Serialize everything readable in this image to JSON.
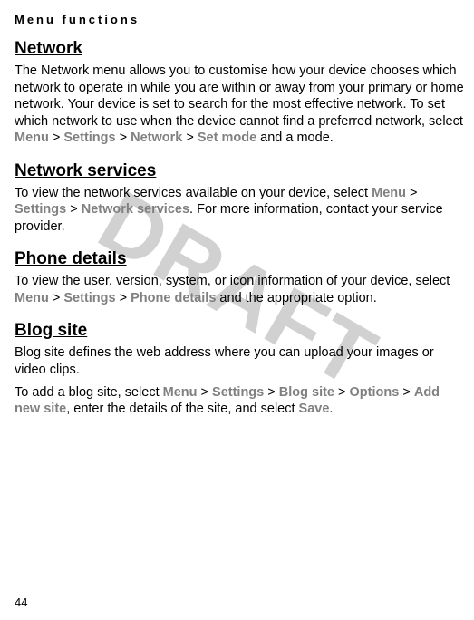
{
  "header": "Menu functions",
  "watermark": "DRAFT",
  "pageNumber": "44",
  "sections": {
    "network": {
      "heading": "Network",
      "p1_a": "The Network menu allows you to customise how your device chooses which network to operate in while you are within or away from your primary or home network. Your device is set to search for the most effective network. To set which network to use when the device cannot find a preferred network, select ",
      "p1_path1": "Menu",
      "p1_sep1": " > ",
      "p1_path2": "Settings",
      "p1_sep2": " > ",
      "p1_path3": "Network",
      "p1_sep3": " > ",
      "p1_path4": "Set mode",
      "p1_b": " and a mode."
    },
    "netServices": {
      "heading": "Network services",
      "p1_a": "To view the network services available on your device, select ",
      "p1_path1": "Menu",
      "p1_sep1": " > ",
      "p1_path2": "Settings",
      "p1_sep2": " > ",
      "p1_path3": "Network services",
      "p1_b": ". For more information, contact your service provider."
    },
    "phoneDetails": {
      "heading": "Phone details",
      "p1_a": "To view the user, version, system, or icon information of your device, select ",
      "p1_path1": "Menu",
      "p1_sep1": " > ",
      "p1_path2": "Settings",
      "p1_sep2": " > ",
      "p1_path3": "Phone details",
      "p1_b": " and the appropriate option."
    },
    "blogSite": {
      "heading": "Blog site",
      "p1": "Blog site defines the web address where you can upload your images or video clips.",
      "p2_a": "To add a blog site, select ",
      "p2_path1": "Menu",
      "p2_sep1": " > ",
      "p2_path2": "Settings",
      "p2_sep2": " > ",
      "p2_path3": "Blog site",
      "p2_sep3": " > ",
      "p2_path4": "Options",
      "p2_sep4": " > ",
      "p2_path5": "Add new site",
      "p2_b": ", enter the details of the site, and select ",
      "p2_path6": "Save",
      "p2_c": "."
    }
  }
}
